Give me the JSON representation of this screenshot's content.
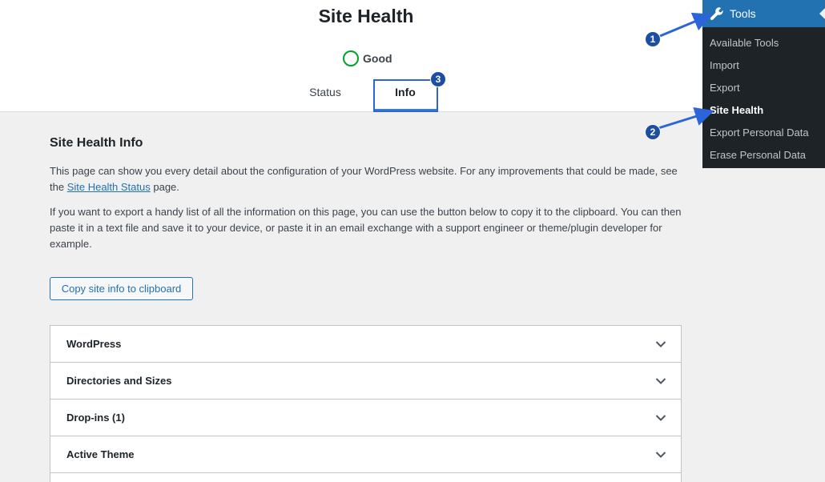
{
  "header": {
    "title": "Site Health",
    "status": "Good",
    "tabs": [
      {
        "label": "Status"
      },
      {
        "label": "Info"
      }
    ]
  },
  "content": {
    "section_title": "Site Health Info",
    "para1_before_link": "This page can show you every detail about the configuration of your WordPress website. For any improvements that could be made, see the ",
    "para1_link": "Site Health Status",
    "para1_after_link": " page.",
    "para2": "If you want to export a handy list of all the information on this page, you can use the button below to copy it to the clipboard. You can then paste it in a text file and save it to your device, or paste it in an email exchange with a support engineer or theme/plugin developer for example.",
    "copy_button": "Copy site info to clipboard",
    "accordion": [
      "WordPress",
      "Directories and Sizes",
      "Drop-ins (1)",
      "Active Theme"
    ]
  },
  "admin_menu": {
    "heading": "Tools",
    "items": [
      "Available Tools",
      "Import",
      "Export",
      "Site Health",
      "Export Personal Data",
      "Erase Personal Data"
    ]
  },
  "callouts": [
    "1",
    "2",
    "3"
  ],
  "colors": {
    "accent": "#2271b1",
    "status_good": "#00a32a",
    "menu_bg": "#1d2327",
    "callout": "#1d4ea3"
  },
  "icons": {
    "menu_heading": "wrench-icon",
    "accordion_toggle": "chevron-down-icon",
    "status": "circle-icon"
  }
}
